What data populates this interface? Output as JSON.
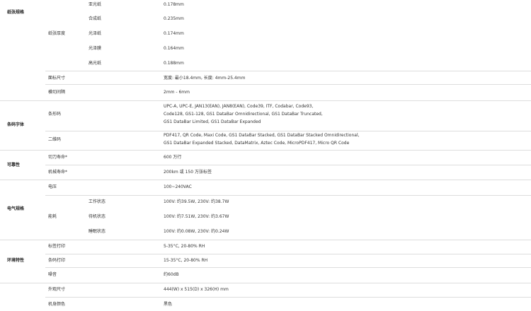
{
  "categories": {
    "paper": "纸张规格",
    "barcode": "条码字体",
    "reliability": "可靠性",
    "electrical": "电气规格",
    "environment": "环境特性"
  },
  "rows": {
    "matte_label": "亚光纸",
    "matte_value": "0.178mm",
    "synthetic_label": "合成纸",
    "synthetic_value": "0.235mm",
    "thickness_label": "纸张厚度",
    "gloss_label": "光泽纸",
    "gloss_value": "0.174mm",
    "gloss_film_label": "光泽膜",
    "gloss_film_value": "0.164mm",
    "high_gloss_label": "高光纸",
    "high_gloss_value": "0.188mm",
    "label_size_label": "面标尺寸",
    "label_size_value": "宽度: 最小18.4mm, 长度: 4mm-25.4mm",
    "cut_gap_label": "横切间隔",
    "cut_gap_value": "2mm - 6mm",
    "barcode_1d_label": "条形码",
    "barcode_1d_value_1": "UPC-A, UPC-E, JAN13(EAN), JAN8(EAN), Code39, ITF, Codabar, Code93,",
    "barcode_1d_value_2": "Code128, GS1-128, GS1 DataBar Omnidirectional, GS1 DataBar Truncated,",
    "barcode_1d_value_3": "GS1 DataBar Limited, GS1 DataBar Expanded",
    "barcode_2d_label": "二维码",
    "barcode_2d_value_1": "PDF417, QR Code, Maxi Code, GS1 DataBar Stacked, GS1 DataBar Stacked Omnidirectional,",
    "barcode_2d_value_2": "GS1 DataBar Expanded Stacked, DataMatrix, Aztec Code, MicroPDF417, Micro QR Code",
    "cutter_life_label": "切刀寿命*",
    "cutter_life_value": "600 万行",
    "head_life_label": "机械寿命*",
    "head_life_value": "200km 或 150 万张标签",
    "voltage_label": "电压",
    "voltage_value": "100~240VAC",
    "power_label": "能耗",
    "working_label": "工作状态",
    "working_value": "100V: 约39.5W, 230V: 约38.7W",
    "standby_label": "待机状态",
    "standby_value": "100V: 约7.51W, 230V: 约3.67W",
    "sleep_label": "睡眠状态",
    "sleep_value": "100V: 约0.08W, 230V: 约0.24W",
    "label_print_label": "标签打印",
    "label_print_value": "5-35°C, 20-80% RH",
    "barcode_print_label": "条码打印",
    "barcode_print_value": "15-35°C, 20-80% RH",
    "noise_label": "噪音",
    "noise_value": "约60dB",
    "dimensions_label": "外观尺寸",
    "dimensions_value": "444(W) x 515(D) x 326(H) mm",
    "color_label": "机身颜色",
    "color_value": "黑色"
  }
}
